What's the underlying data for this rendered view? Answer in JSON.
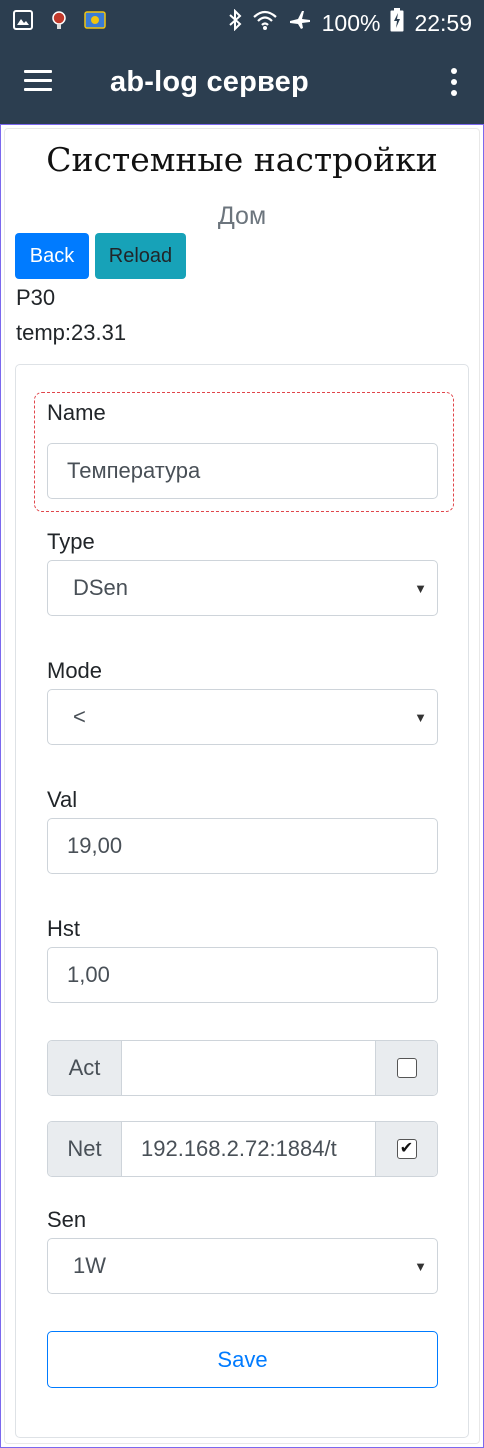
{
  "status_bar": {
    "battery": "100%",
    "time": "22:59",
    "icons": [
      "image-icon",
      "notification-icon",
      "app-icon",
      "bluetooth-icon",
      "wifi-icon",
      "airplane-icon",
      "battery-icon"
    ]
  },
  "app_bar": {
    "title": "ab-log сервер"
  },
  "page": {
    "title": "Системные настройки",
    "subtitle": "Дом",
    "back_label": "Back",
    "reload_label": "Reload",
    "port": "P30",
    "temp": "temp:23.31"
  },
  "form": {
    "name_label": "Name",
    "name_value": "Температура",
    "type_label": "Type",
    "type_value": "DSen",
    "mode_label": "Mode",
    "mode_value": "<",
    "val_label": "Val",
    "val_value": "19,00",
    "hst_label": "Hst",
    "hst_value": "1,00",
    "act_label": "Act",
    "act_value": "",
    "act_checked": false,
    "net_label": "Net",
    "net_value": "192.168.2.72:1884/t",
    "net_checked": true,
    "sen_label": "Sen",
    "sen_value": "1W",
    "save_label": "Save"
  },
  "colors": {
    "app_bar": "#2c3e50",
    "primary": "#007bff",
    "info": "#17a2b8",
    "highlight_border": "#e0454a"
  }
}
